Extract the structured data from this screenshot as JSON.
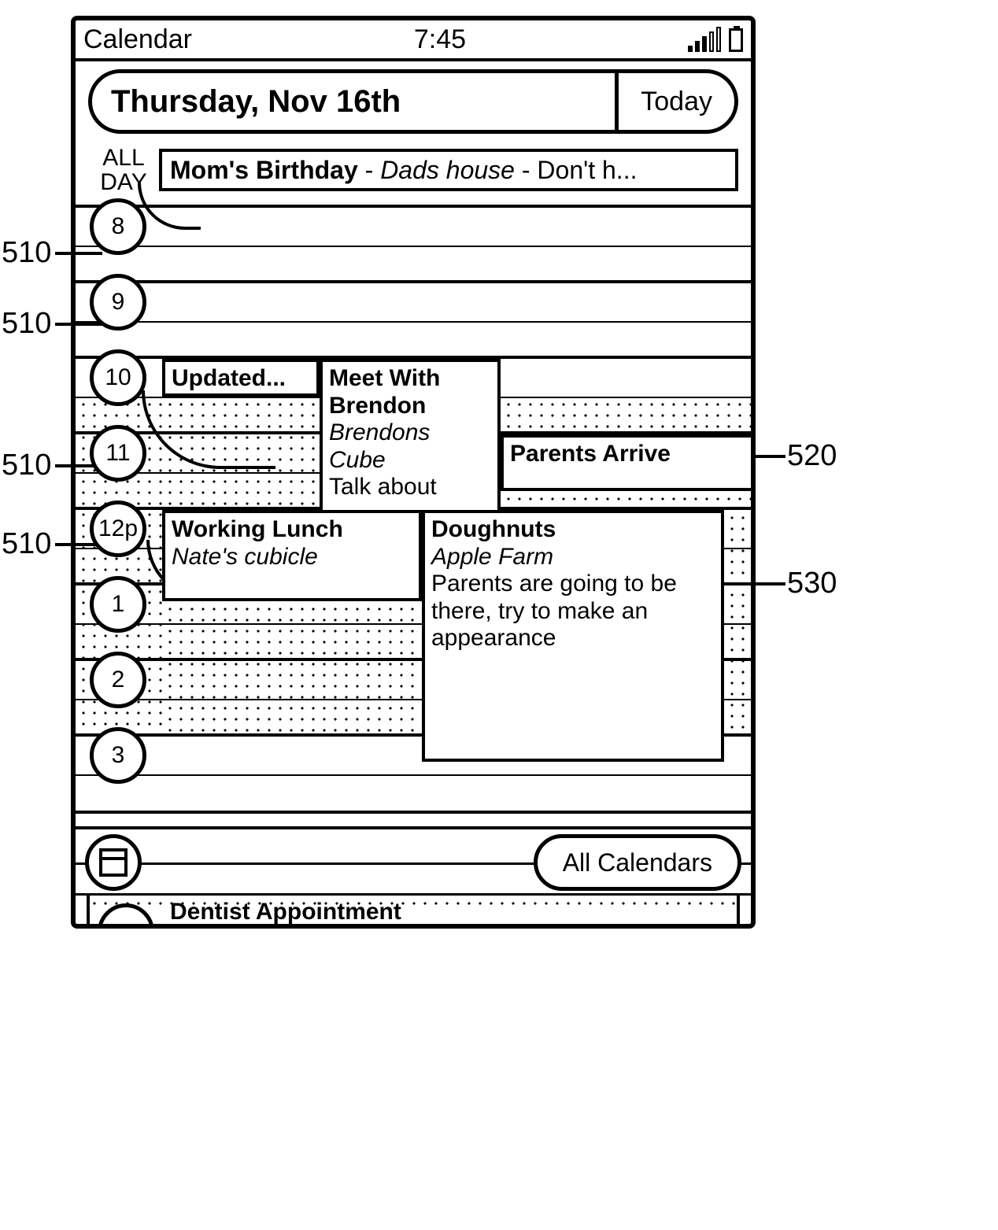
{
  "status": {
    "title": "Calendar",
    "time": "7:45"
  },
  "date_pill": {
    "date": "Thursday, Nov 16th",
    "today": "Today"
  },
  "allday": {
    "label_top": "ALL",
    "label_bot": "DAY",
    "event_title": "Mom's Birthday",
    "event_loc": "Dads house",
    "event_note": "Don't h..."
  },
  "hours": [
    "8",
    "9",
    "10",
    "11",
    "12p",
    "1",
    "2",
    "3"
  ],
  "events": {
    "updated": {
      "title": "Updated..."
    },
    "brendon": {
      "title": "Meet With Brendon",
      "loc": "Brendons Cube",
      "note": "Talk about"
    },
    "parents": {
      "title": "Parents Arrive"
    },
    "lunch": {
      "title": "Working Lunch",
      "loc": "Nate's cubicle"
    },
    "doughnuts": {
      "title": "Doughnuts",
      "loc": "Apple Farm",
      "note": "Parents are going to be there, try to make an appearance"
    },
    "dentist": {
      "title": "Dentist Appointment"
    }
  },
  "footer": {
    "all_calendars": "All Calendars"
  },
  "annotations": {
    "a510": "510",
    "a520": "520",
    "a530": "530"
  }
}
